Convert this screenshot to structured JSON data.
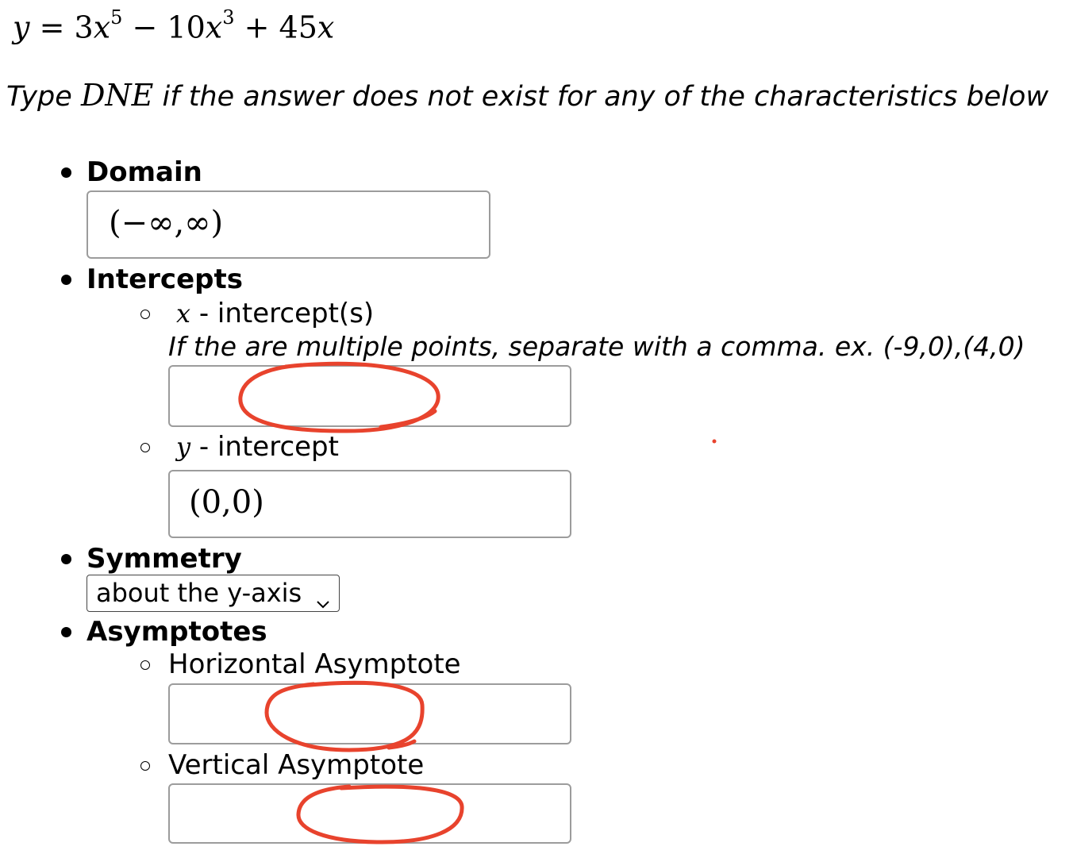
{
  "equation": {
    "lhs": "y",
    "equals": "=",
    "term1_coef": "3",
    "term1_var": "x",
    "term1_exp": "5",
    "minus": "−",
    "term2_coef": "10",
    "term2_var": "x",
    "term2_exp": "3",
    "plus": "+",
    "term3_coef": "45",
    "term3_var": "x"
  },
  "instruction": {
    "before": "Type ",
    "dne": "DNE",
    "after": " if the answer does not exist for any of the characteristics below"
  },
  "domain": {
    "heading": "Domain",
    "value": "(−∞,∞)"
  },
  "intercepts": {
    "heading": "Intercepts",
    "x_var": "x",
    "x_label": " - intercept(s)",
    "x_hint": "If the are multiple points, separate with a comma. ex. (-9,0),(4,0)",
    "x_value": "",
    "y_var": "y",
    "y_label": " - intercept",
    "y_value": "(0,0)"
  },
  "symmetry": {
    "heading": "Symmetry",
    "selected": "about the y-axis"
  },
  "asymptotes": {
    "heading": "Asymptotes",
    "horizontal_label": "Horizontal Asymptote",
    "horizontal_value": "",
    "vertical_label": "Vertical Asymptote",
    "vertical_value": ""
  },
  "colors": {
    "annotation": "#e8432d",
    "field_border": "#9c9c9c"
  }
}
